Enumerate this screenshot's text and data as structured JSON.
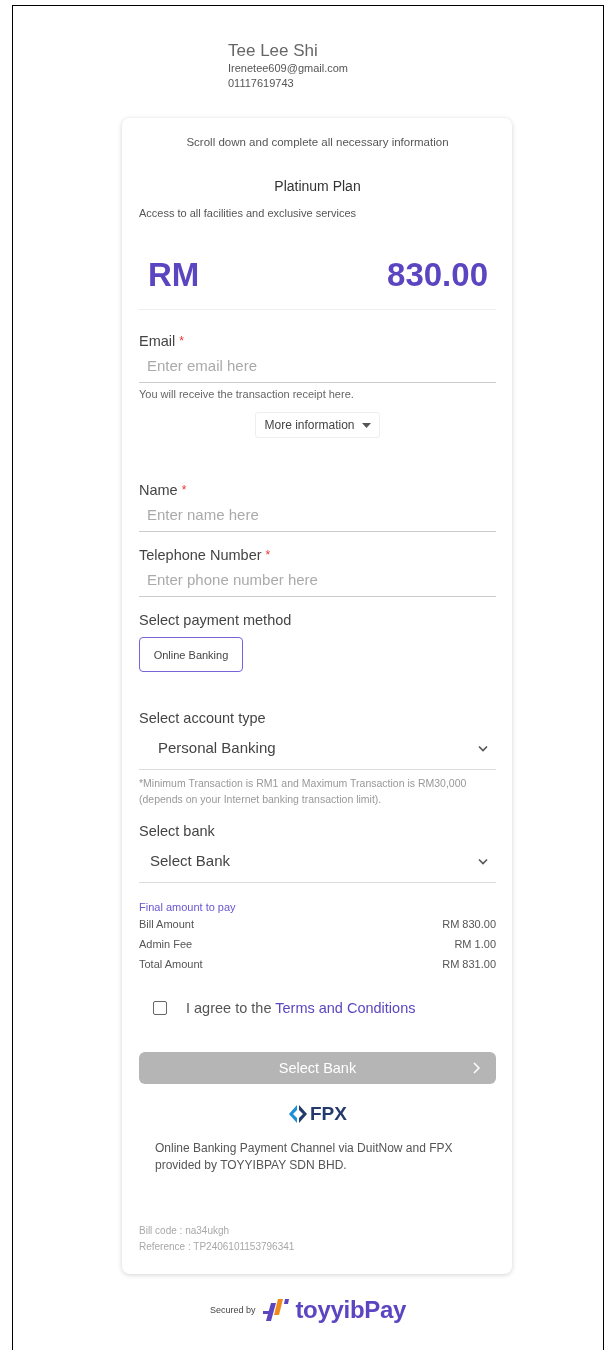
{
  "header": {
    "name": "Tee Lee Shi",
    "email": "Irenetee609@gmail.com",
    "phone": "01117619743"
  },
  "card": {
    "instruction": "Scroll down and complete all necessary information",
    "plan": {
      "title": "Platinum Plan",
      "description": "Access to all facilities and exclusive services",
      "currency": "RM",
      "amount": "830.00"
    },
    "fields": [
      {
        "label": "Email",
        "required_mark": "*",
        "placeholder": "Enter email here",
        "hint": "You will receive the transaction receipt here.",
        "button": "More information"
      },
      {
        "label": "Name",
        "required_mark": "*",
        "placeholder": "Enter name here"
      },
      {
        "label": "Telephone Number",
        "required_mark": "*",
        "placeholder": "Enter phone number here"
      }
    ],
    "payment_method": {
      "label": "Select payment method",
      "options": [
        {
          "label": "Online Banking",
          "selected": true
        }
      ]
    },
    "account_type": {
      "label": "Select account type",
      "value": "Personal Banking"
    },
    "note": "*Minimum Transaction is RM1 and Maximum Transaction is RM30,000 (depends on your Internet banking transaction limit).",
    "bank": {
      "label": "Select bank",
      "value": "Select Bank"
    },
    "summary": {
      "title": "Final amount to pay",
      "rows": [
        {
          "label": "Bill Amount",
          "value": "RM 830.00"
        },
        {
          "label": "Admin Fee",
          "value": "RM 1.00"
        },
        {
          "label": "Total Amount",
          "value": "RM 831.00"
        }
      ]
    },
    "agreement": {
      "text": "I agree to the",
      "link": "Terms and Conditions",
      "checked": false
    },
    "submit": {
      "label": "Select Bank",
      "disabled": true
    },
    "fpx": {
      "logo": "FPX",
      "description": "Online Banking Payment Channel via DuitNow and FPX provided by TOYYIBPAY SDN BHD."
    },
    "bill_code": "Bill code : na34ukgh",
    "reference": "Reference : TP2406101153796341"
  },
  "footer": {
    "secured_by": "Secured by",
    "logo": "toyyibPay"
  }
}
